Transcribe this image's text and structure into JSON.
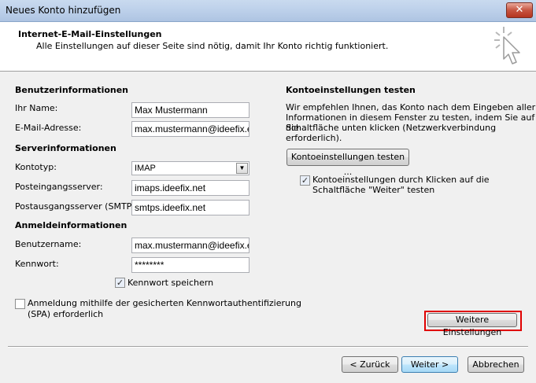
{
  "window": {
    "title": "Neues Konto hinzufügen",
    "close": "✕"
  },
  "header": {
    "title": "Internet-E-Mail-Einstellungen",
    "subtitle": "Alle Einstellungen auf dieser Seite sind nötig, damit Ihr Konto richtig funktioniert."
  },
  "user_info": {
    "heading": "Benutzerinformationen",
    "name_label": "Ihr Name:",
    "name_value": "Max Mustermann",
    "email_label": "E-Mail-Adresse:",
    "email_value": "max.mustermann@ideefix.eu"
  },
  "server_info": {
    "heading": "Serverinformationen",
    "account_type_label": "Kontotyp:",
    "account_type_value": "IMAP",
    "incoming_label": "Posteingangsserver:",
    "incoming_value": "imaps.ideefix.net",
    "outgoing_label": "Postausgangsserver (SMTP):",
    "outgoing_value": "smtps.ideefix.net"
  },
  "login_info": {
    "heading": "Anmeldeinformationen",
    "username_label": "Benutzername:",
    "username_value": "max.mustermann@ideefix.eu",
    "password_label": "Kennwort:",
    "password_value": "********",
    "save_password_label": "Kennwort speichern",
    "save_password_checked": true,
    "spa_label_line1": "Anmeldung mithilfe der gesicherten Kennwortauthentifizierung",
    "spa_label_line2": "(SPA) erforderlich",
    "spa_checked": false
  },
  "test_settings": {
    "heading": "Kontoeinstellungen testen",
    "desc_line1": "Wir empfehlen Ihnen, das Konto nach dem Eingeben aller",
    "desc_line2": "Informationen in diesem Fenster zu testen, indem Sie auf die",
    "desc_line3": "Schaltfläche unten klicken (Netzwerkverbindung erforderlich).",
    "test_button": "Kontoeinstellungen testen ...",
    "auto_test_line1": "Kontoeinstellungen durch Klicken auf die",
    "auto_test_line2": "Schaltfläche \"Weiter\" testen",
    "auto_test_checked": true
  },
  "more_settings_button": "Weitere Einstellungen",
  "nav": {
    "back": "< Zurück",
    "next": "Weiter >",
    "cancel": "Abbrechen"
  },
  "colors": {
    "highlight": "#e00000",
    "default_button_border": "#3c7fb1"
  }
}
